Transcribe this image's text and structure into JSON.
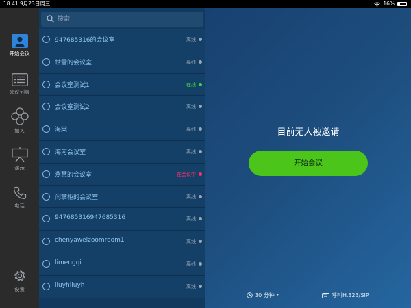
{
  "status_bar": {
    "time": "18:41",
    "date": "9月23日周三",
    "battery": "16%"
  },
  "sidebar": {
    "items": [
      {
        "label": "开始会议",
        "icon": "person-icon",
        "active": true
      },
      {
        "label": "会议列表",
        "icon": "list-icon"
      },
      {
        "label": "加入",
        "icon": "join-icon"
      },
      {
        "label": "演示",
        "icon": "presentation-icon"
      },
      {
        "label": "电话",
        "icon": "phone-icon"
      },
      {
        "label": "设置",
        "icon": "gear-icon"
      }
    ]
  },
  "search": {
    "placeholder": "搜索"
  },
  "rooms": [
    {
      "name": "947685316的会议室",
      "status": "离线",
      "status_color": "#9aa8b5"
    },
    {
      "name": "世雪的会议室",
      "status": "离线",
      "status_color": "#9aa8b5"
    },
    {
      "name": "会议室测试1",
      "status": "在线",
      "status_color": "#3fd13f"
    },
    {
      "name": "会议室测试2",
      "status": "离线",
      "status_color": "#9aa8b5"
    },
    {
      "name": "海棠",
      "status": "离线",
      "status_color": "#9aa8b5"
    },
    {
      "name": "海河会议室",
      "status": "离线",
      "status_color": "#9aa8b5"
    },
    {
      "name": "燕慧的会议室",
      "status": "在会议中",
      "status_color": "#ff2d6a"
    },
    {
      "name": "闫掌柜的会议室",
      "status": "离线",
      "status_color": "#9aa8b5"
    },
    {
      "name": "947685316947685316",
      "status": "离线",
      "status_color": "#9aa8b5"
    },
    {
      "name": "chenyaweizoomroom1",
      "status": "离线",
      "status_color": "#9aa8b5"
    },
    {
      "name": "limengqi",
      "status": "离线",
      "status_color": "#9aa8b5"
    },
    {
      "name": "liuyhliuyh",
      "status": "离线",
      "status_color": "#9aa8b5"
    }
  ],
  "main": {
    "headline": "目前无人被邀请",
    "start_button": "开始会议",
    "footer_duration": "30 分钟",
    "footer_call": "呼叫H.323/SIP"
  },
  "colors": {
    "accent": "#4cc51a",
    "sidebar_bg": "#2b2b2b",
    "list_bg": "#144068"
  }
}
